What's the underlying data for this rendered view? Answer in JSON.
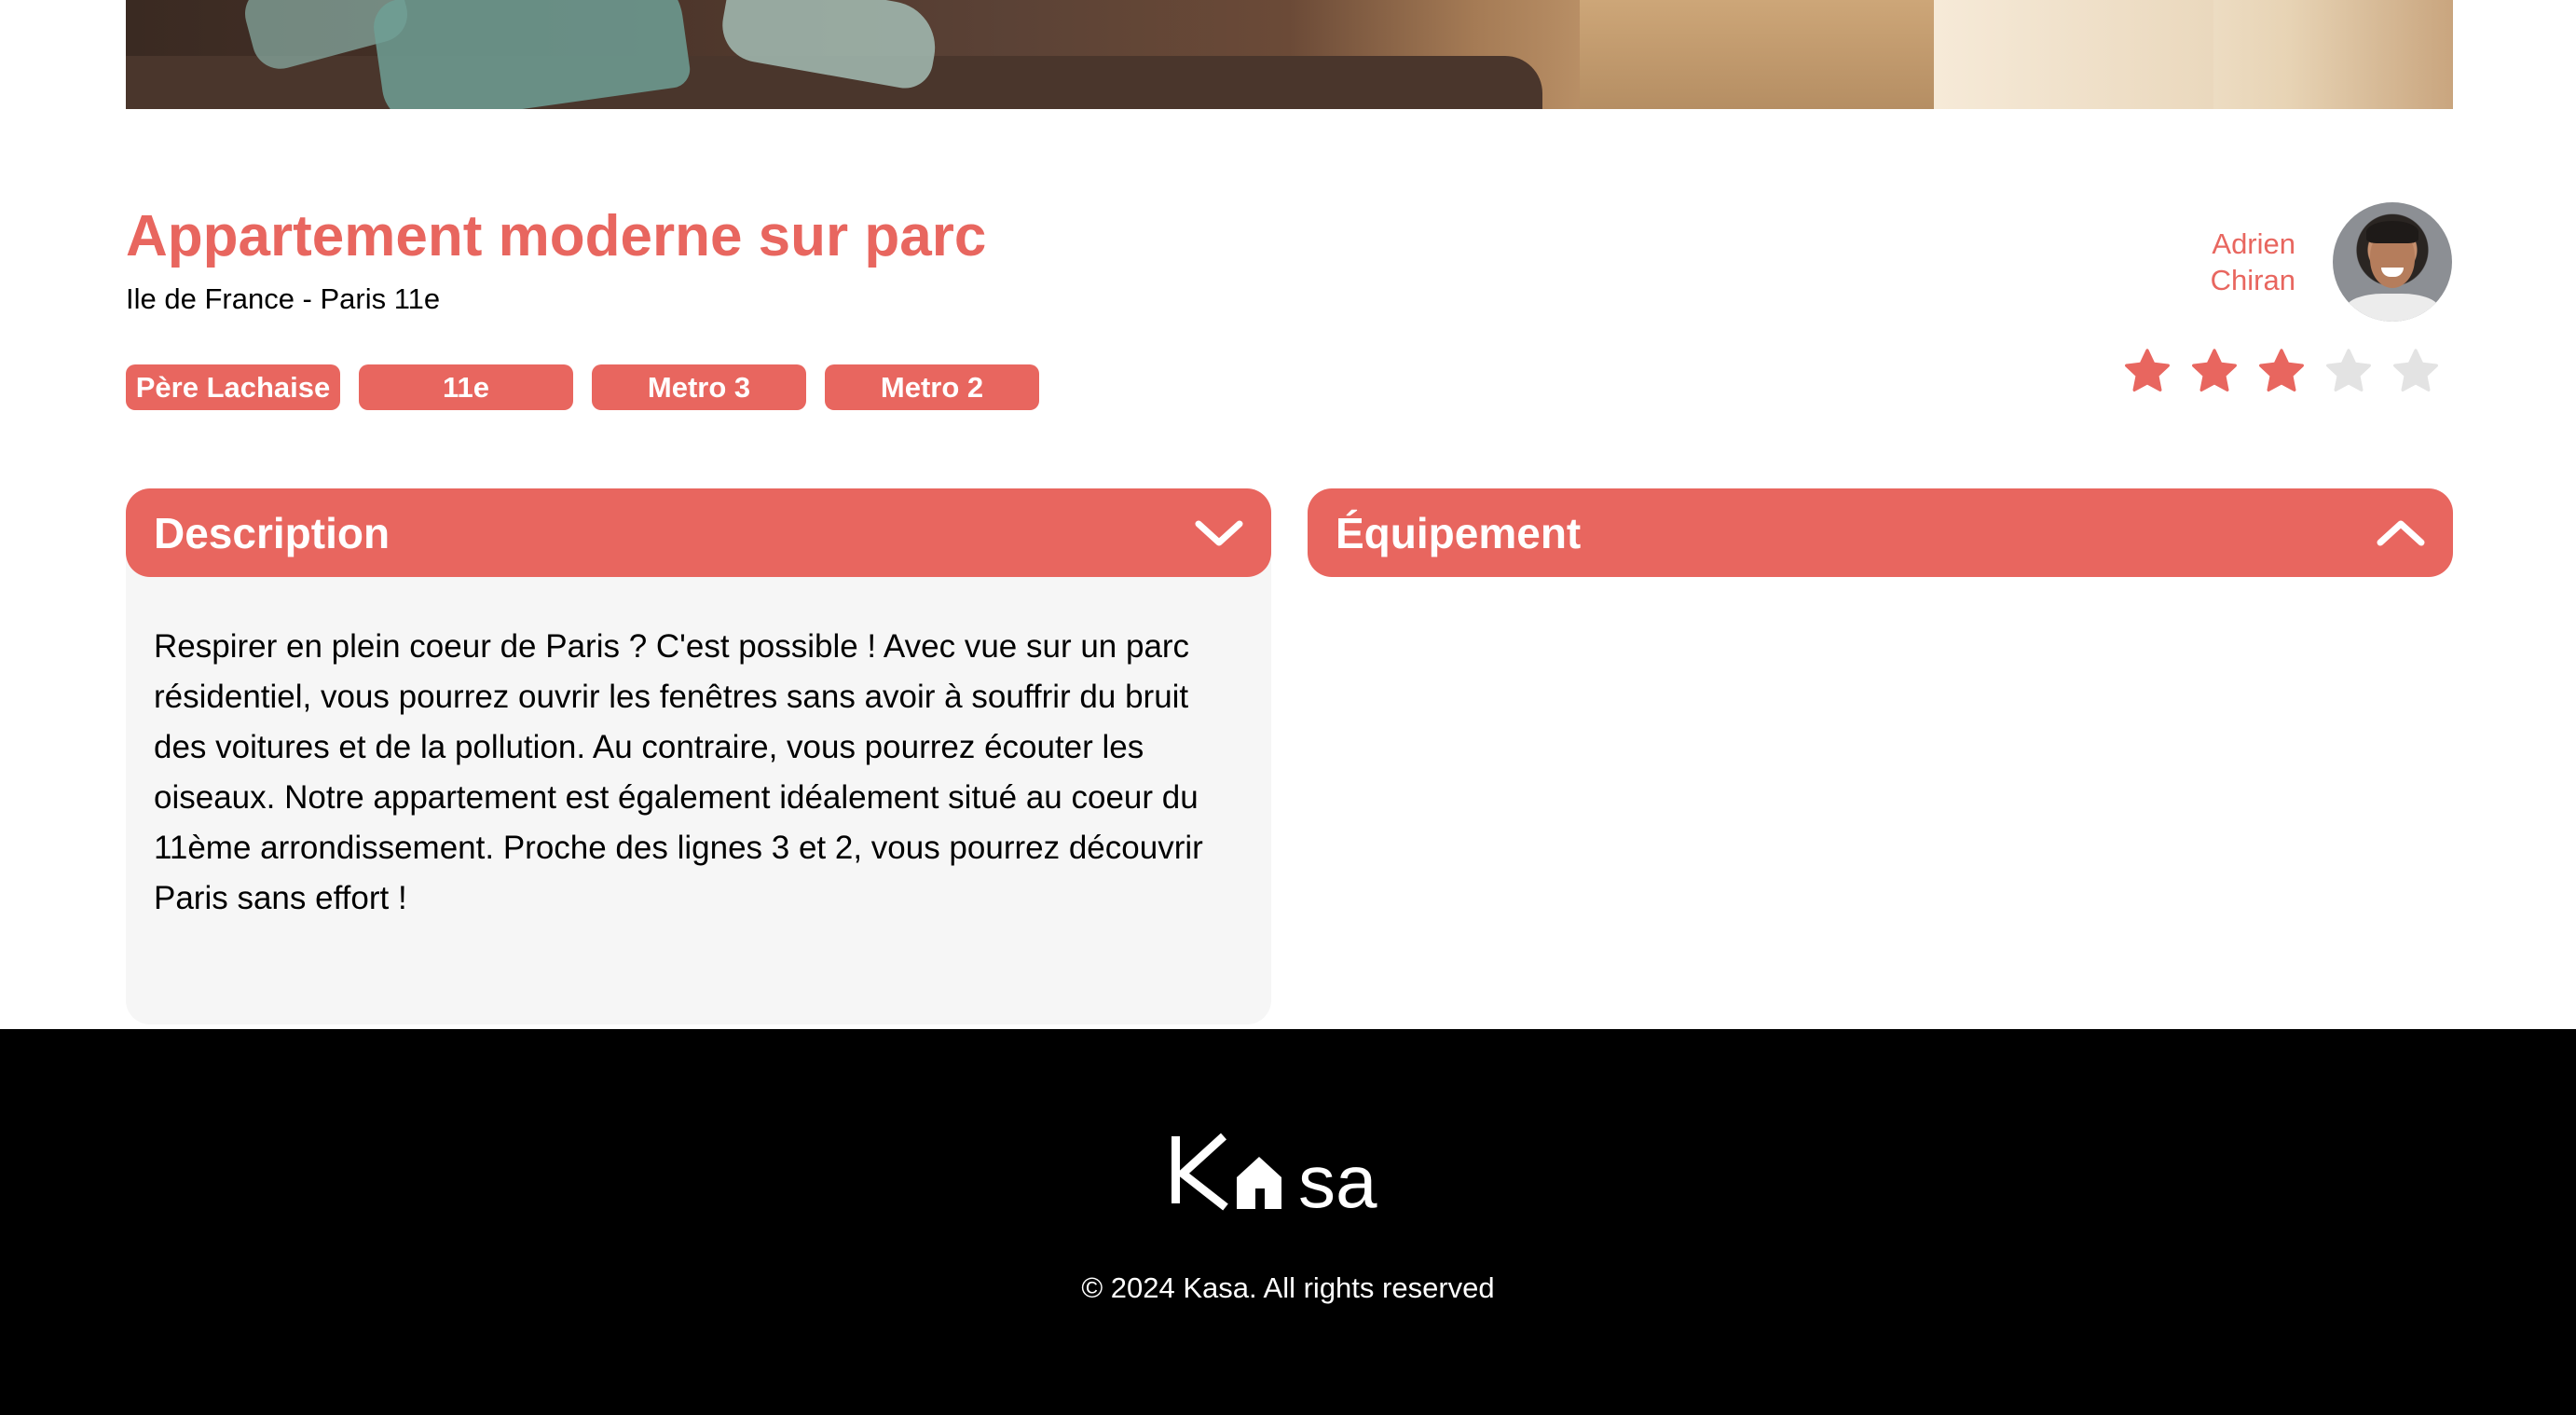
{
  "listing": {
    "title": "Appartement moderne sur parc",
    "location": "Ile de France - Paris 11e",
    "tags": [
      "Père Lachaise",
      "11e",
      "Metro 3",
      "Metro 2"
    ],
    "host": {
      "first_name": "Adrien",
      "last_name": "Chiran"
    },
    "rating": 3,
    "rating_max": 5
  },
  "collapses": {
    "description": {
      "title": "Description",
      "icon": "chevron-down-icon",
      "text": "Respirer en plein coeur de Paris ? C'est possible ! Avec vue sur un parc résidentiel, vous pourrez ouvrir les fenêtres sans avoir à souffrir du bruit des voitures et de la pollution. Au contraire, vous pourrez écouter les oiseaux. Notre appartement est également idéalement situé au coeur du 11ème arrondissement. Proche des lignes 3 et 2, vous pourrez découvrir Paris sans effort !"
    },
    "equipment": {
      "title": "Équipement",
      "icon": "chevron-up-icon"
    }
  },
  "footer": {
    "logo_text": "Kasa",
    "copyright": "© 2024 Kasa. All rights reserved"
  },
  "colors": {
    "accent": "#E8665F",
    "star_inactive": "#E3E3E3",
    "panel_bg": "#F6F6F6",
    "footer_bg": "#000000"
  }
}
